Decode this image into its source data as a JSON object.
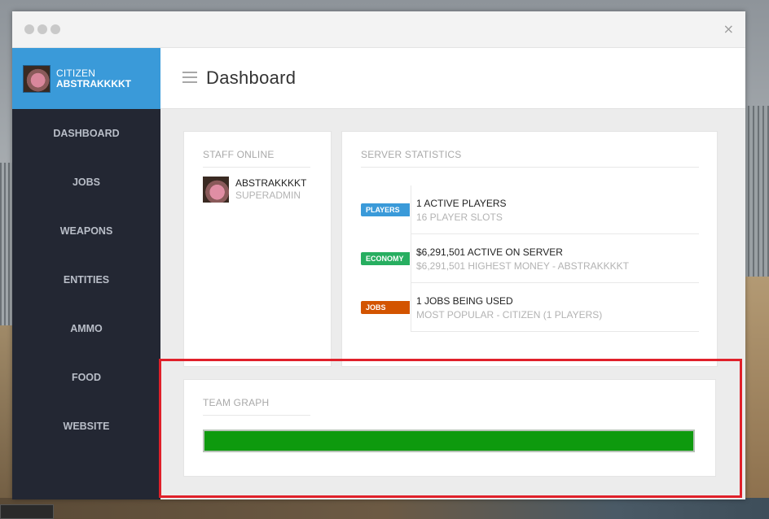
{
  "window": {
    "close_glyph": "×"
  },
  "sidebar": {
    "user": {
      "role": "CITIZEN",
      "name": "ABSTRAKKKKT"
    },
    "items": [
      {
        "label": "DASHBOARD"
      },
      {
        "label": "JOBS"
      },
      {
        "label": "WEAPONS"
      },
      {
        "label": "ENTITIES"
      },
      {
        "label": "AMMO"
      },
      {
        "label": "FOOD"
      },
      {
        "label": "WEBSITE"
      }
    ]
  },
  "header": {
    "title": "Dashboard"
  },
  "staff": {
    "title": "STAFF ONLINE",
    "members": [
      {
        "name": "ABSTRAKKKKT",
        "rank": "SUPERADMIN"
      }
    ]
  },
  "stats": {
    "title": "SERVER STATISTICS",
    "rows": [
      {
        "badge": "PLAYERS",
        "badge_color": "#3a9ad9",
        "main": "1 ACTIVE PLAYERS",
        "sub": "16 PLAYER SLOTS"
      },
      {
        "badge": "ECONOMY",
        "badge_color": "#27ae60",
        "main": "$6,291,501 ACTIVE ON SERVER",
        "sub": "$6,291,501 HIGHEST MONEY - ABSTRAKKKKT"
      },
      {
        "badge": "JOBS",
        "badge_color": "#d35400",
        "main": "1 JOBS BEING USED",
        "sub": "MOST POPULAR - CITIZEN (1 PLAYERS)"
      }
    ]
  },
  "team_graph": {
    "title": "TEAM GRAPH",
    "fill_fraction": 1.0,
    "bar_color": "#0e9a0e"
  },
  "colors": {
    "accent": "#3a9ad9",
    "sidebar_bg": "#232733",
    "highlight": "#e0202a"
  }
}
